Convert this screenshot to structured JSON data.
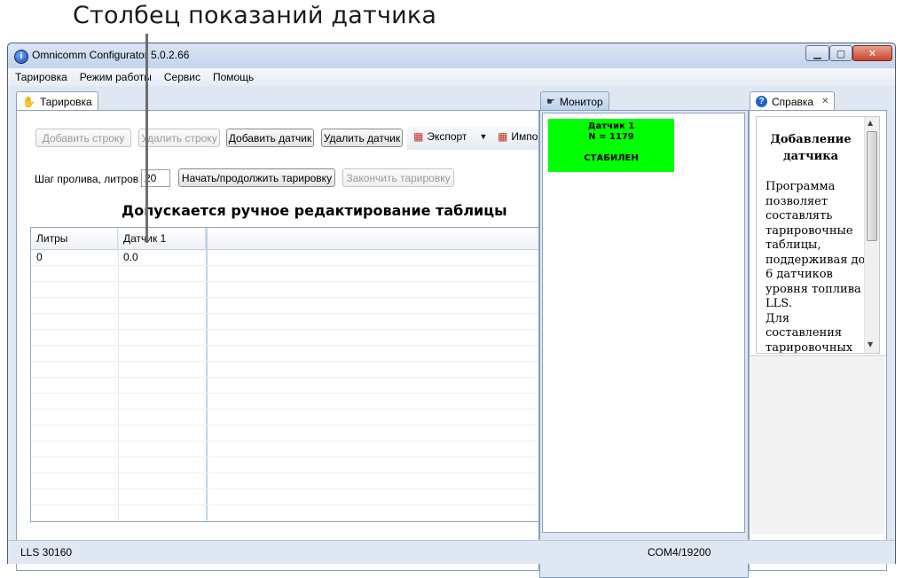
{
  "annotation": {
    "text": "Столбец показаний датчика"
  },
  "window": {
    "title": "Omnicomm Configurator 5.0.2.66"
  },
  "menu": [
    "Тарировка",
    "Режим работы",
    "Сервис",
    "Помощь"
  ],
  "calibration": {
    "tab_label": "Тарировка",
    "buttons": {
      "add_row": "Добавить строку",
      "delete_row": "Удалить строку",
      "add_sensor": "Добавить датчик",
      "delete_sensor": "Удалить датчик",
      "export": "Экспорт",
      "import": "Импо"
    },
    "step_label": "Шаг пролива, литров",
    "step_value": "20",
    "start_button": "Начать/продолжить тарировку",
    "finish_button": "Закончить тарировку",
    "heading": "Допускается ручное редактирование таблицы",
    "table": {
      "columns": [
        "Литры",
        "Датчик 1"
      ],
      "rows": [
        [
          "0",
          "0.0"
        ]
      ]
    }
  },
  "monitor": {
    "tab_label": "Монитор",
    "sensor_name": "Датчик 1",
    "sensor_value": "N = 1179",
    "sensor_status": "СТАБИЛЕН",
    "status_color": "#00ff00"
  },
  "help": {
    "tab_label": "Справка",
    "title_line1": "Добавление",
    "title_line2": "датчика",
    "body_lines": [
      "Программа",
      "позволяет",
      "составлять",
      "тарировочные",
      "таблицы,",
      "поддерживая до",
      "6 датчиков",
      "уровня топлива",
      "LLS.",
      "Для",
      "составления",
      "тарировочных"
    ]
  },
  "status": {
    "device": "LLS 30160",
    "port": "COM4/19200"
  }
}
